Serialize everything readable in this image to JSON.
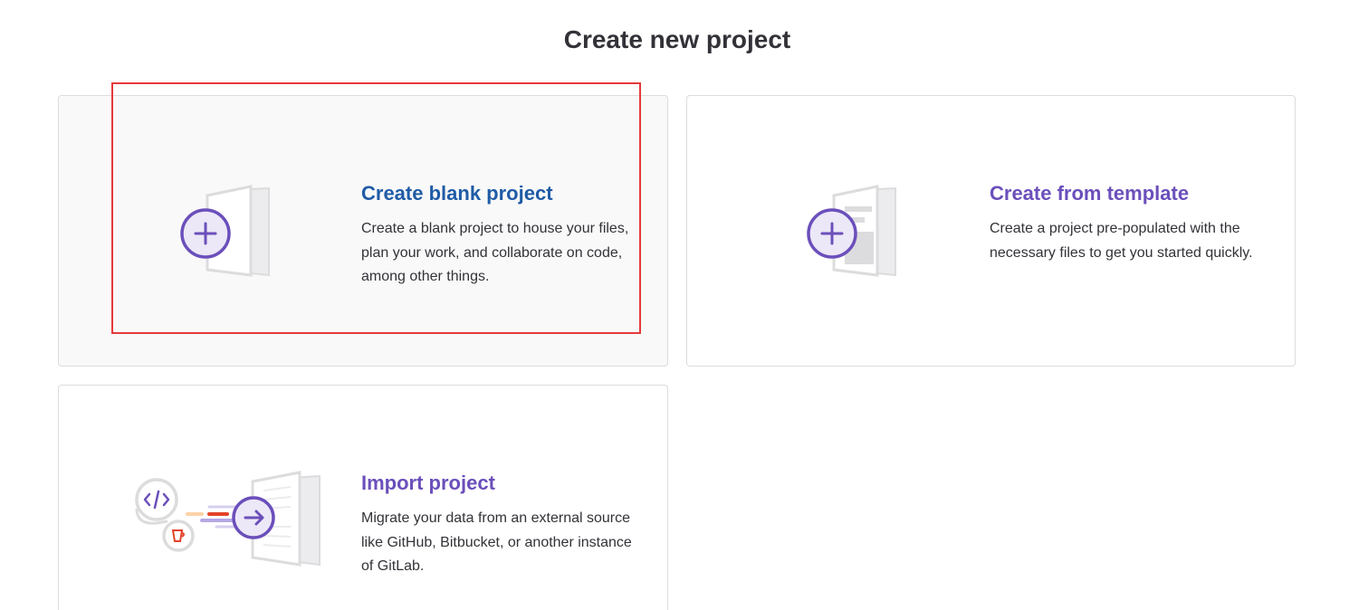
{
  "page": {
    "title": "Create new project"
  },
  "cards": {
    "blank": {
      "heading": "Create blank project",
      "description": "Create a blank project to house your files, plan your work, and collaborate on code, among other things.",
      "icon": "plus-document-icon"
    },
    "template": {
      "heading": "Create from template",
      "description": "Create a project pre-populated with the necessary files to get you started quickly.",
      "icon": "template-document-icon"
    },
    "import": {
      "heading": "Import project",
      "description": "Migrate your data from an external source like GitHub, Bitbucket, or another instance of GitLab.",
      "icon": "import-arrow-icon"
    }
  },
  "colors": {
    "accent_purple": "#6b4fbb",
    "heading_blue": "#1f5ba6",
    "highlight_red": "#e5393b",
    "import_orange": "#e24329"
  }
}
